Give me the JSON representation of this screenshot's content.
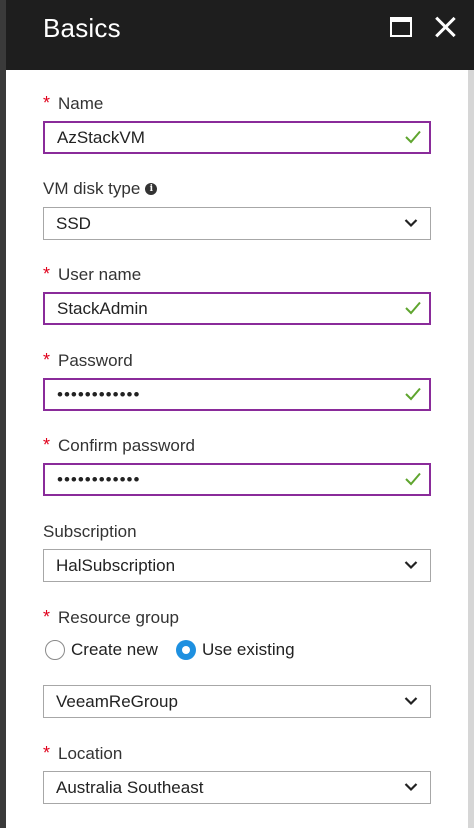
{
  "header": {
    "title": "Basics"
  },
  "name": {
    "label": "Name",
    "value": "AzStackVM"
  },
  "disk": {
    "label": "VM disk type",
    "value": "SSD"
  },
  "user": {
    "label": "User name",
    "value": "StackAdmin"
  },
  "password": {
    "label": "Password",
    "value": "••••••••••••"
  },
  "confirm": {
    "label": "Confirm password",
    "value": "••••••••••••"
  },
  "subscription": {
    "label": "Subscription",
    "value": "HalSubscription"
  },
  "resource_group": {
    "label": "Resource group",
    "option_new": "Create new",
    "option_existing": "Use existing",
    "value": "VeeamReGroup"
  },
  "location": {
    "label": "Location",
    "value": "Australia Southeast"
  },
  "icons": {
    "info": "i",
    "required": "*"
  },
  "colors": {
    "valid_border": "#8a2b9a",
    "check": "#5fa52f",
    "radio_on": "#1e90e0",
    "required": "#e0001b",
    "header_bg": "#1e1e1e"
  }
}
